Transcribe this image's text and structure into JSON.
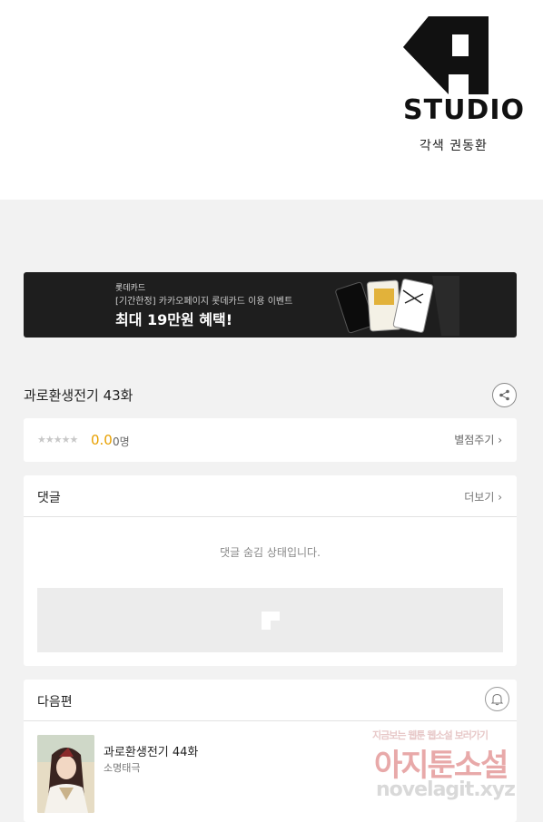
{
  "art": {
    "logo_text": "STUDIO",
    "credit": "각색 권동환"
  },
  "banner": {
    "brand": "롯데카드",
    "sub": "[기간한정] 카카오페이지 롯데카드 이용 이벤트",
    "headline": "최대 19만원 혜택!"
  },
  "episode": {
    "title": "과로환생전기 43화",
    "share_icon": "share-icon"
  },
  "rating": {
    "stars": "★★★★★",
    "score": "0.0",
    "people": "0명",
    "rate_link": "별점주기 ›"
  },
  "comments": {
    "label": "댓글",
    "more_link": "더보기 ›",
    "hidden_msg": "댓글 숨김 상태입니다."
  },
  "next": {
    "label": "다음편",
    "bell_icon": "bell-icon",
    "title": "과로환생전기 44화",
    "author": "소명태극"
  },
  "watermark": {
    "top": "지금보는 웹툰 웹소설 보러가기",
    "mid": "아지툰소설",
    "url": "novelagit.xyz"
  }
}
